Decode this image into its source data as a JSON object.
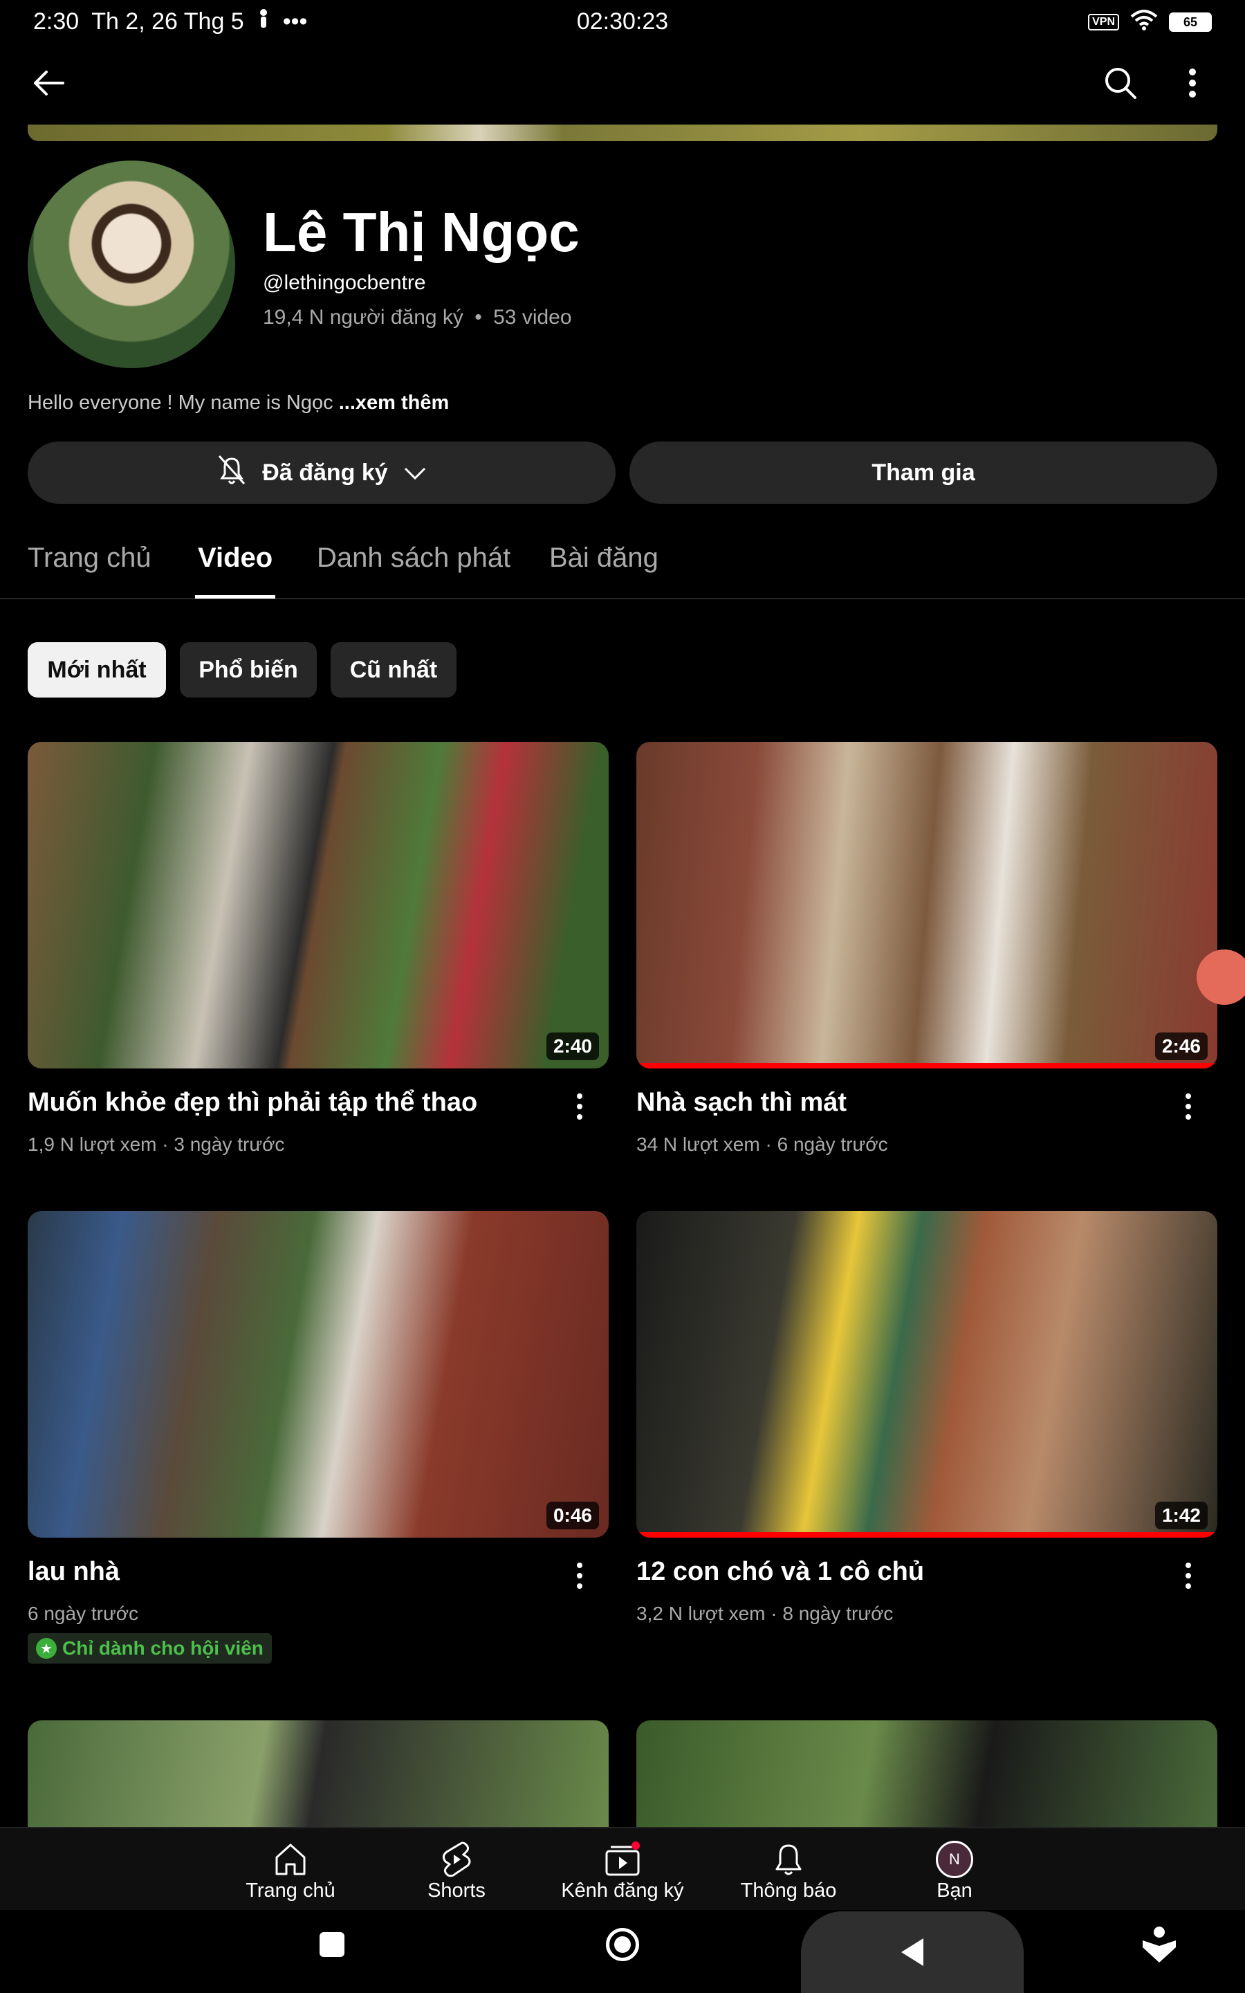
{
  "status_bar": {
    "time": "2:30",
    "date": "Th 2, 26 Thg 5",
    "center_time": "02:30:23",
    "vpn": "VPN",
    "battery": "65"
  },
  "channel": {
    "name": "Lê Thị Ngọc",
    "handle": "@lethingocbentre",
    "subscribers": "19,4 N người đăng ký",
    "videos": "53 video",
    "separator": "•",
    "description": "Hello everyone ! My name is Ngọc",
    "more": "...xem thêm"
  },
  "actions": {
    "subscribed": "Đã đăng ký",
    "join": "Tham gia"
  },
  "tabs": [
    "Trang chủ",
    "Video",
    "Danh sách phát",
    "Bài đăng"
  ],
  "active_tab": "Video",
  "chips": [
    "Mới nhất",
    "Phổ biến",
    "Cũ nhất"
  ],
  "videos": [
    {
      "title": "Muốn khỏe đẹp thì phải tập thể thao",
      "meta": "1,9 N lượt xem · 3 ngày trước",
      "duration": "2:40",
      "progress": 0
    },
    {
      "title": "Nhà sạch thì mát",
      "meta": "34 N lượt xem · 6 ngày trước",
      "duration": "2:46",
      "progress": 1.0
    },
    {
      "title": "lau nhà",
      "meta": "6 ngày trước",
      "duration": "0:46",
      "progress": 0,
      "badge": "Chỉ dành cho hội viên"
    },
    {
      "title": "12 con chó và 1 cô chủ",
      "meta": "3,2 N lượt xem · 8 ngày trước",
      "duration": "1:42",
      "progress": 1.0
    }
  ],
  "bottom_nav": [
    "Trang chủ",
    "Shorts",
    "Kênh đăng ký",
    "Thông báo",
    "Bạn"
  ],
  "avatar_initial": "N",
  "colors": {
    "accent": "#ff0000",
    "members": "#3cae3c"
  }
}
